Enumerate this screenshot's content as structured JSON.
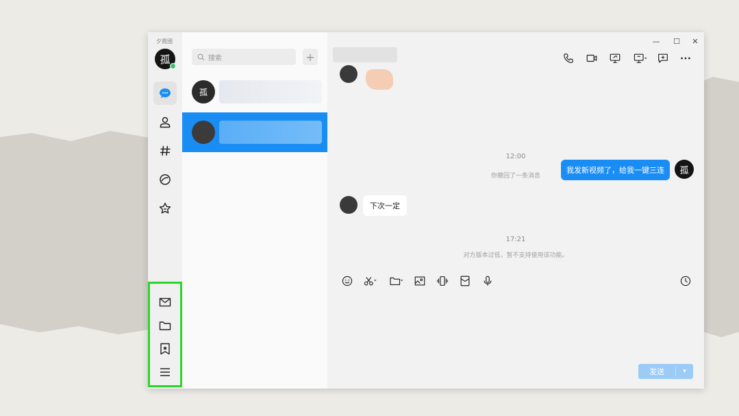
{
  "app": {
    "name": "夕霞國"
  },
  "me": {
    "avatar_glyph": "孤"
  },
  "search": {
    "placeholder": "搜索",
    "add_label": "+"
  },
  "chats": [
    {
      "avatar_glyph": "孤",
      "selected": false
    },
    {
      "avatar_glyph": "",
      "selected": true
    }
  ],
  "window_controls": {
    "minimize": "—",
    "maximize": "☐",
    "close": "✕"
  },
  "messages": {
    "time1": "12:00",
    "system1": "你撤回了一条消息",
    "outgoing_text": "我发新视频了，给我一键三连",
    "incoming_text": "下次一定",
    "time2": "17:21",
    "system2": "对方版本过低，暂不支持使用该功能。"
  },
  "composer": {
    "send_label": "发送",
    "send_arrow": "▾"
  },
  "colors": {
    "accent": "#1a8df4",
    "highlight": "#2ad62a",
    "send_disabled": "#9ccbf6"
  }
}
